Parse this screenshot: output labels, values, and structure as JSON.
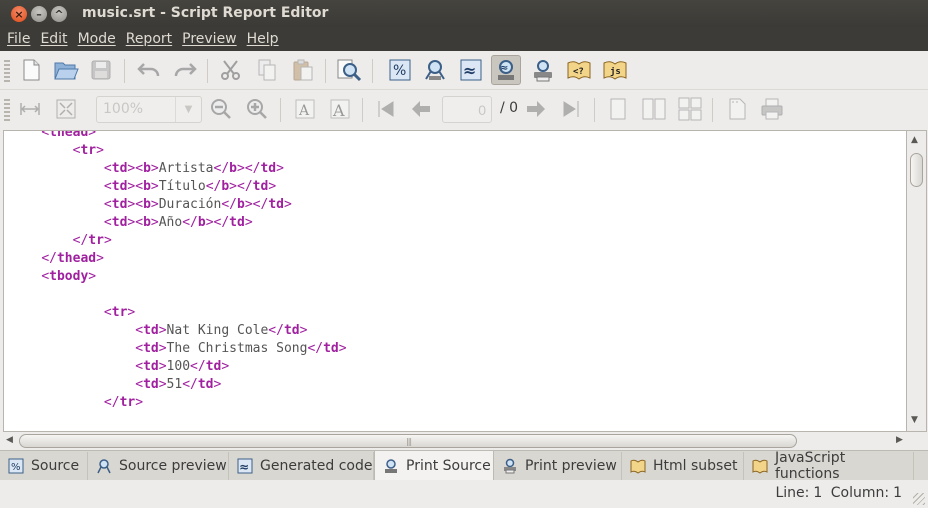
{
  "window": {
    "title": "music.srt - Script Report Editor"
  },
  "menu": [
    "File",
    "Edit",
    "Mode",
    "Report",
    "Preview",
    "Help"
  ],
  "toolbar2": {
    "zoom_value": "100%",
    "page_value": "0",
    "page_total": "/ 0"
  },
  "editor": {
    "lines": [
      [
        {
          "t": "    ",
          "c": "txt"
        },
        {
          "t": "<",
          "c": "tag"
        },
        {
          "t": "thead",
          "c": "tagname"
        },
        {
          "t": ">",
          "c": "tag"
        }
      ],
      [
        {
          "t": "        ",
          "c": "txt"
        },
        {
          "t": "<",
          "c": "tag"
        },
        {
          "t": "tr",
          "c": "tagname"
        },
        {
          "t": ">",
          "c": "tag"
        }
      ],
      [
        {
          "t": "            ",
          "c": "txt"
        },
        {
          "t": "<",
          "c": "tag"
        },
        {
          "t": "td",
          "c": "tagname"
        },
        {
          "t": "><",
          "c": "tag"
        },
        {
          "t": "b",
          "c": "tagname"
        },
        {
          "t": ">",
          "c": "tag"
        },
        {
          "t": "Artista",
          "c": "txt"
        },
        {
          "t": "</",
          "c": "tag"
        },
        {
          "t": "b",
          "c": "tagname"
        },
        {
          "t": "></",
          "c": "tag"
        },
        {
          "t": "td",
          "c": "tagname"
        },
        {
          "t": ">",
          "c": "tag"
        }
      ],
      [
        {
          "t": "            ",
          "c": "txt"
        },
        {
          "t": "<",
          "c": "tag"
        },
        {
          "t": "td",
          "c": "tagname"
        },
        {
          "t": "><",
          "c": "tag"
        },
        {
          "t": "b",
          "c": "tagname"
        },
        {
          "t": ">",
          "c": "tag"
        },
        {
          "t": "Título",
          "c": "txt"
        },
        {
          "t": "</",
          "c": "tag"
        },
        {
          "t": "b",
          "c": "tagname"
        },
        {
          "t": "></",
          "c": "tag"
        },
        {
          "t": "td",
          "c": "tagname"
        },
        {
          "t": ">",
          "c": "tag"
        }
      ],
      [
        {
          "t": "            ",
          "c": "txt"
        },
        {
          "t": "<",
          "c": "tag"
        },
        {
          "t": "td",
          "c": "tagname"
        },
        {
          "t": "><",
          "c": "tag"
        },
        {
          "t": "b",
          "c": "tagname"
        },
        {
          "t": ">",
          "c": "tag"
        },
        {
          "t": "Duración",
          "c": "txt"
        },
        {
          "t": "</",
          "c": "tag"
        },
        {
          "t": "b",
          "c": "tagname"
        },
        {
          "t": "></",
          "c": "tag"
        },
        {
          "t": "td",
          "c": "tagname"
        },
        {
          "t": ">",
          "c": "tag"
        }
      ],
      [
        {
          "t": "            ",
          "c": "txt"
        },
        {
          "t": "<",
          "c": "tag"
        },
        {
          "t": "td",
          "c": "tagname"
        },
        {
          "t": "><",
          "c": "tag"
        },
        {
          "t": "b",
          "c": "tagname"
        },
        {
          "t": ">",
          "c": "tag"
        },
        {
          "t": "Año",
          "c": "txt"
        },
        {
          "t": "</",
          "c": "tag"
        },
        {
          "t": "b",
          "c": "tagname"
        },
        {
          "t": "></",
          "c": "tag"
        },
        {
          "t": "td",
          "c": "tagname"
        },
        {
          "t": ">",
          "c": "tag"
        }
      ],
      [
        {
          "t": "        ",
          "c": "txt"
        },
        {
          "t": "</",
          "c": "tag"
        },
        {
          "t": "tr",
          "c": "tagname"
        },
        {
          "t": ">",
          "c": "tag"
        }
      ],
      [
        {
          "t": "    ",
          "c": "txt"
        },
        {
          "t": "</",
          "c": "tag"
        },
        {
          "t": "thead",
          "c": "tagname"
        },
        {
          "t": ">",
          "c": "tag"
        }
      ],
      [
        {
          "t": "    ",
          "c": "txt"
        },
        {
          "t": "<",
          "c": "tag"
        },
        {
          "t": "tbody",
          "c": "tagname"
        },
        {
          "t": ">",
          "c": "tag"
        }
      ],
      [],
      [
        {
          "t": "            ",
          "c": "txt"
        },
        {
          "t": "<",
          "c": "tag"
        },
        {
          "t": "tr",
          "c": "tagname"
        },
        {
          "t": ">",
          "c": "tag"
        }
      ],
      [
        {
          "t": "                ",
          "c": "txt"
        },
        {
          "t": "<",
          "c": "tag"
        },
        {
          "t": "td",
          "c": "tagname"
        },
        {
          "t": ">",
          "c": "tag"
        },
        {
          "t": "Nat King Cole",
          "c": "txt"
        },
        {
          "t": "</",
          "c": "tag"
        },
        {
          "t": "td",
          "c": "tagname"
        },
        {
          "t": ">",
          "c": "tag"
        }
      ],
      [
        {
          "t": "                ",
          "c": "txt"
        },
        {
          "t": "<",
          "c": "tag"
        },
        {
          "t": "td",
          "c": "tagname"
        },
        {
          "t": ">",
          "c": "tag"
        },
        {
          "t": "The Christmas Song",
          "c": "txt"
        },
        {
          "t": "</",
          "c": "tag"
        },
        {
          "t": "td",
          "c": "tagname"
        },
        {
          "t": ">",
          "c": "tag"
        }
      ],
      [
        {
          "t": "                ",
          "c": "txt"
        },
        {
          "t": "<",
          "c": "tag"
        },
        {
          "t": "td",
          "c": "tagname"
        },
        {
          "t": ">",
          "c": "tag"
        },
        {
          "t": "100",
          "c": "txt"
        },
        {
          "t": "</",
          "c": "tag"
        },
        {
          "t": "td",
          "c": "tagname"
        },
        {
          "t": ">",
          "c": "tag"
        }
      ],
      [
        {
          "t": "                ",
          "c": "txt"
        },
        {
          "t": "<",
          "c": "tag"
        },
        {
          "t": "td",
          "c": "tagname"
        },
        {
          "t": ">",
          "c": "tag"
        },
        {
          "t": "51",
          "c": "txt"
        },
        {
          "t": "</",
          "c": "tag"
        },
        {
          "t": "td",
          "c": "tagname"
        },
        {
          "t": ">",
          "c": "tag"
        }
      ],
      [
        {
          "t": "            ",
          "c": "txt"
        },
        {
          "t": "</",
          "c": "tag"
        },
        {
          "t": "tr",
          "c": "tagname"
        },
        {
          "t": ">",
          "c": "tag"
        }
      ]
    ]
  },
  "tabs": [
    {
      "label": "Source",
      "icon": "source-icon"
    },
    {
      "label": "Source preview",
      "icon": "source-preview-icon"
    },
    {
      "label": "Generated code",
      "icon": "generated-code-icon"
    },
    {
      "label": "Print Source",
      "icon": "print-source-icon"
    },
    {
      "label": "Print preview",
      "icon": "print-preview-icon"
    },
    {
      "label": "Html subset",
      "icon": "html-subset-icon"
    },
    {
      "label": "JavaScript functions",
      "icon": "javascript-functions-icon"
    }
  ],
  "selected_tab": "Print Source",
  "status": {
    "line_label": "Line:",
    "line_value": "1",
    "column_label": "Column:",
    "column_value": "1"
  },
  "colors": {
    "tag": "#a020a0",
    "text": "#555555",
    "titlebar": "#3c3b37",
    "window_bg": "#edeceb"
  }
}
